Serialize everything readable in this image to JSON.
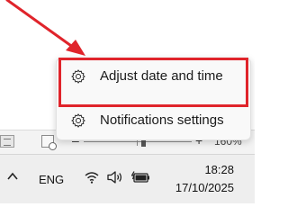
{
  "context_menu": {
    "items": [
      {
        "label": "Adjust date and time",
        "icon": "gear-icon",
        "highlighted": true
      },
      {
        "label": "Notifications settings",
        "icon": "gear-icon",
        "highlighted": false
      }
    ]
  },
  "status_bar": {
    "zoom_minus": "–",
    "zoom_plus": "+",
    "zoom_percent": "160%"
  },
  "taskbar": {
    "language": "ENG",
    "time": "18:28",
    "date": "17/10/2025"
  },
  "annotation": {
    "color": "#e0242b"
  }
}
